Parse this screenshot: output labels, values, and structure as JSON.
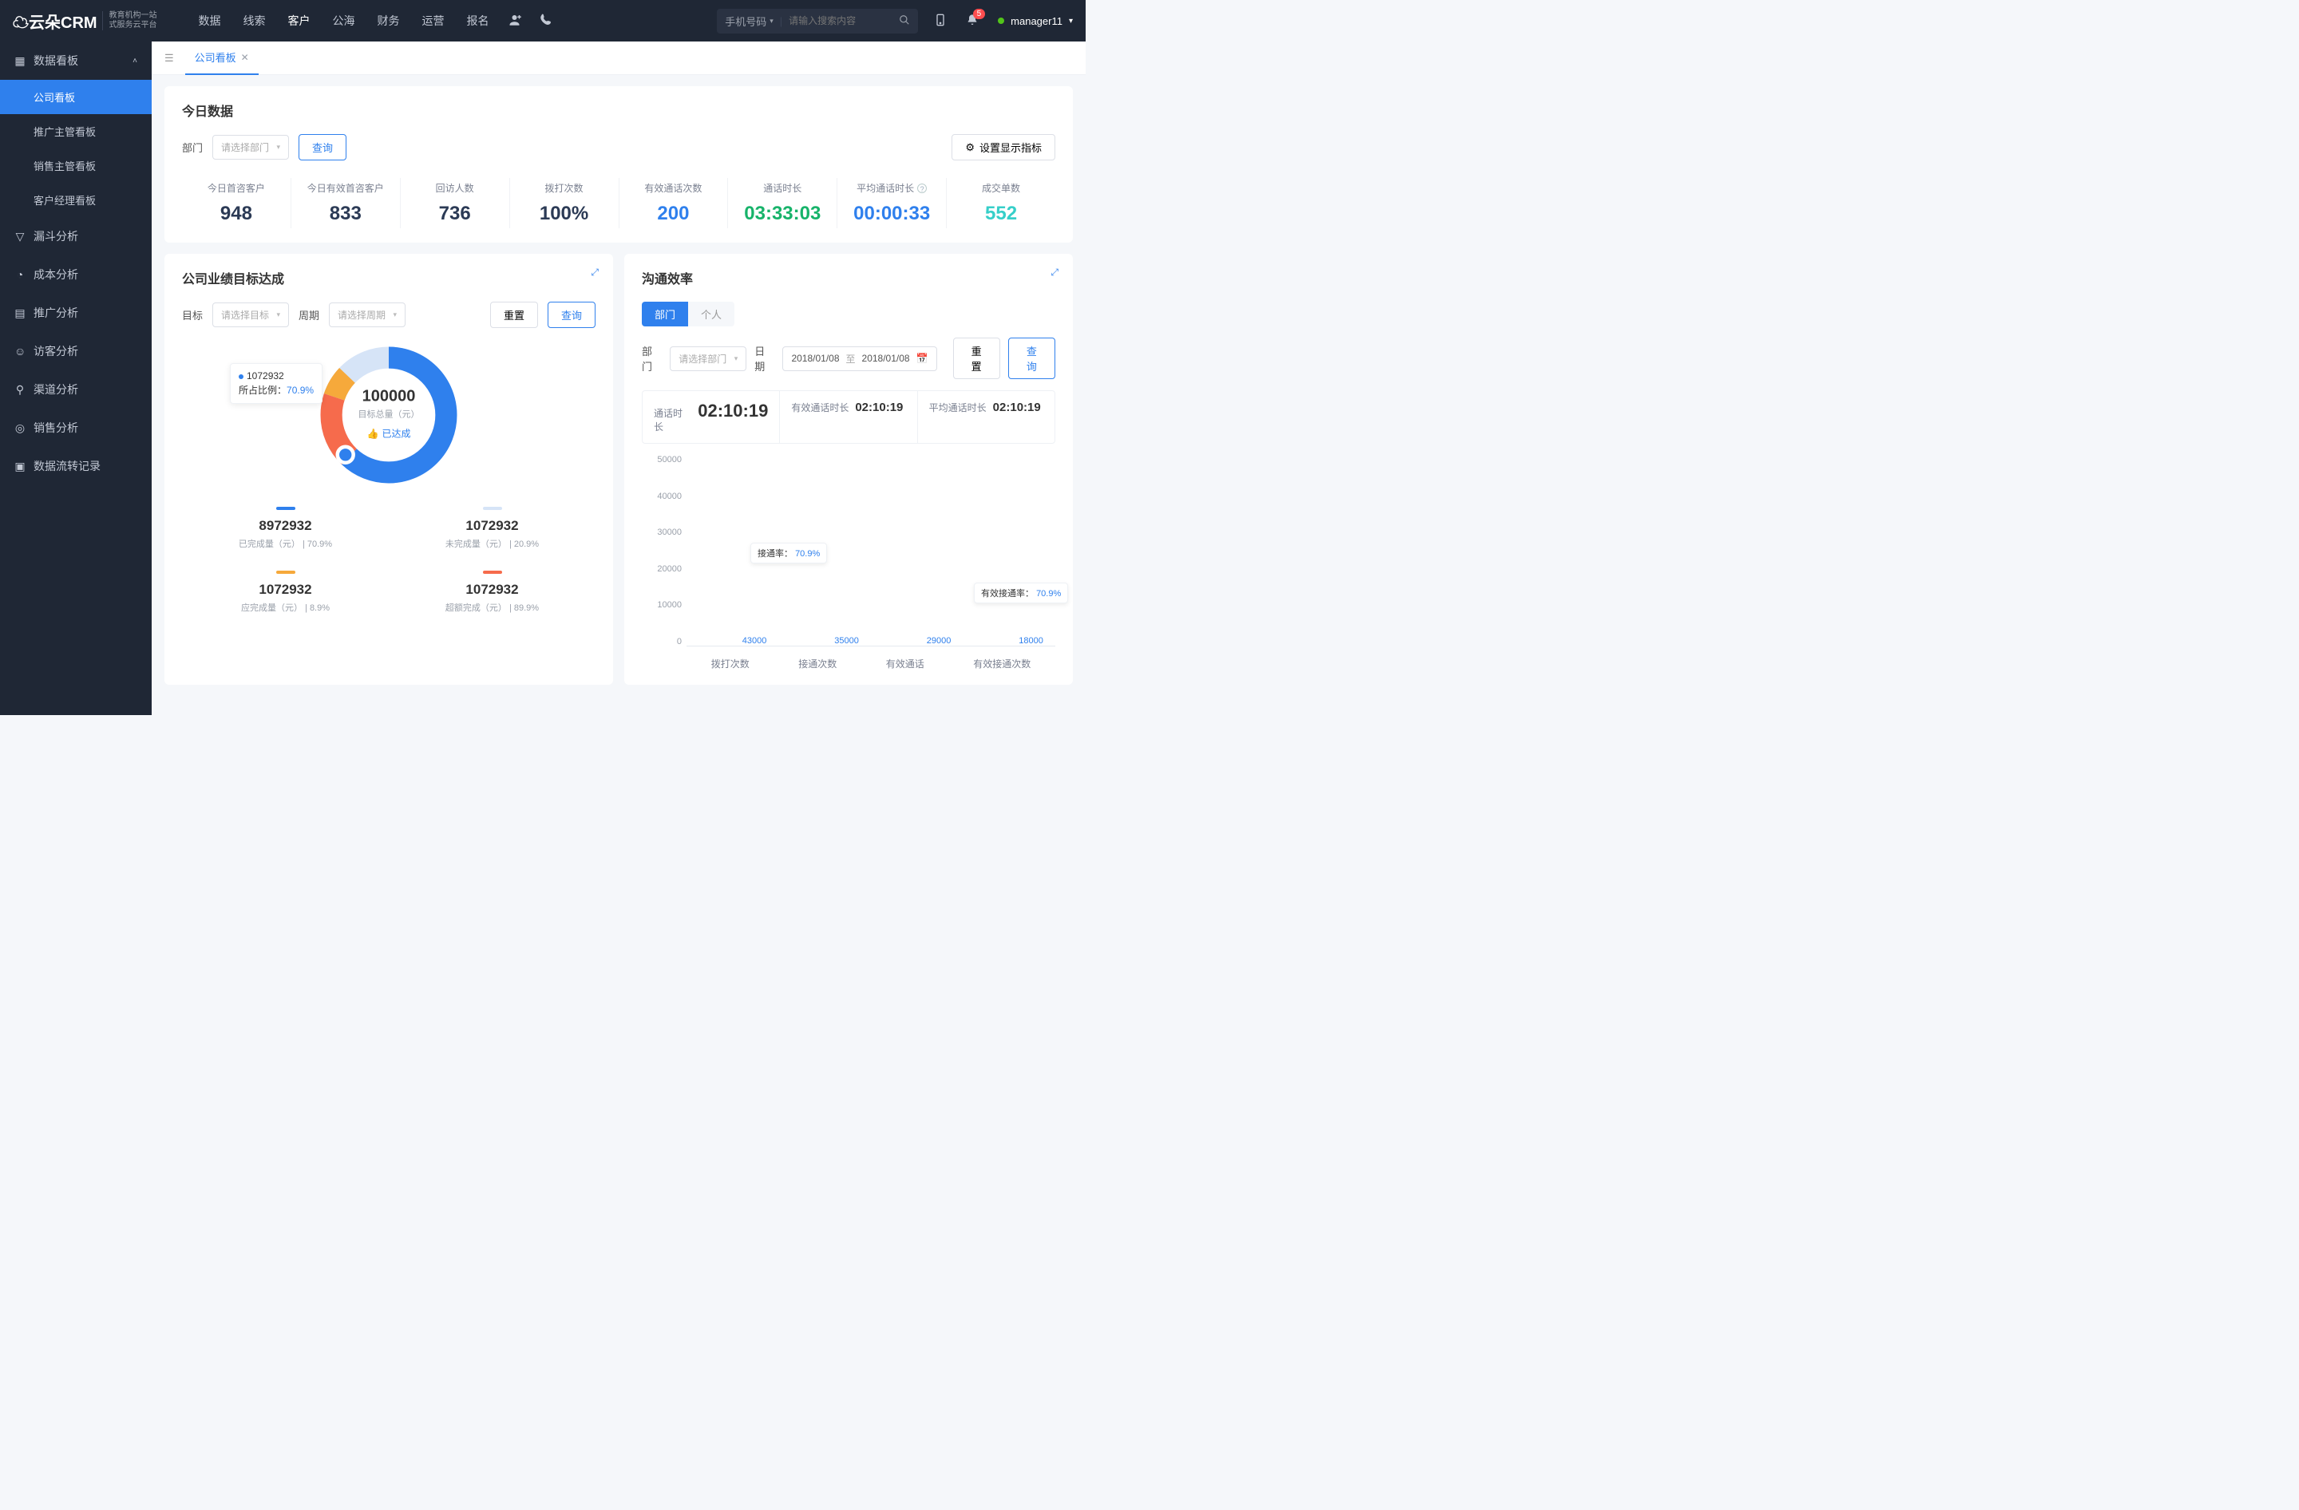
{
  "header": {
    "logo": "云朵CRM",
    "logoUrl": "www.yunduocrm.com",
    "logoSub1": "教育机构一站",
    "logoSub2": "式服务云平台",
    "nav": [
      "数据",
      "线索",
      "客户",
      "公海",
      "财务",
      "运营",
      "报名"
    ],
    "navActive": 2,
    "searchType": "手机号码",
    "searchPlaceholder": "请输入搜索内容",
    "notifCount": "5",
    "user": "manager11"
  },
  "sidebar": {
    "group": "数据看板",
    "subs": [
      "公司看板",
      "推广主管看板",
      "销售主管看板",
      "客户经理看板"
    ],
    "subActive": 0,
    "items": [
      {
        "icon": "▽",
        "label": "漏斗分析"
      },
      {
        "icon": "◔",
        "label": "成本分析"
      },
      {
        "icon": "▤",
        "label": "推广分析"
      },
      {
        "icon": "☺",
        "label": "访客分析"
      },
      {
        "icon": "⚲",
        "label": "渠道分析"
      },
      {
        "icon": "◎",
        "label": "销售分析"
      },
      {
        "icon": "▣",
        "label": "数据流转记录"
      }
    ]
  },
  "tab": {
    "label": "公司看板"
  },
  "today": {
    "title": "今日数据",
    "deptLabel": "部门",
    "deptPlaceholder": "请选择部门",
    "query": "查询",
    "settingsBtn": "设置显示指标",
    "metrics": [
      {
        "label": "今日首咨客户",
        "value": "948",
        "cls": "c-navy"
      },
      {
        "label": "今日有效首咨客户",
        "value": "833",
        "cls": "c-navy"
      },
      {
        "label": "回访人数",
        "value": "736",
        "cls": "c-navy"
      },
      {
        "label": "拨打次数",
        "value": "100%",
        "cls": "c-navy"
      },
      {
        "label": "有效通话次数",
        "value": "200",
        "cls": "c-blue"
      },
      {
        "label": "通话时长",
        "value": "03:33:03",
        "cls": "c-green"
      },
      {
        "label": "平均通话时长",
        "value": "00:00:33",
        "cls": "c-blue",
        "help": true
      },
      {
        "label": "成交单数",
        "value": "552",
        "cls": "c-cyan"
      }
    ]
  },
  "target": {
    "title": "公司业绩目标达成",
    "goalLabel": "目标",
    "goalPlaceholder": "请选择目标",
    "periodLabel": "周期",
    "periodPlaceholder": "请选择周期",
    "reset": "重置",
    "query": "查询",
    "centerValue": "100000",
    "centerSub": "目标总量（元）",
    "centerTag": "已达成",
    "tipValue": "1072932",
    "tipRatioLabel": "所占比例：",
    "tipRatio": "70.9%",
    "stats": [
      {
        "color": "#2f80ed",
        "value": "8972932",
        "sub": "已完成量（元） | 70.9%"
      },
      {
        "color": "#d6e4f7",
        "value": "1072932",
        "sub": "未完成量（元） | 20.9%"
      },
      {
        "color": "#f6a93b",
        "value": "1072932",
        "sub": "应完成量（元） | 8.9%"
      },
      {
        "color": "#f66b4c",
        "value": "1072932",
        "sub": "超额完成（元） | 89.9%"
      }
    ]
  },
  "eff": {
    "title": "沟通效率",
    "tabs": [
      "部门",
      "个人"
    ],
    "tabActive": 0,
    "deptLabel": "部门",
    "deptPlaceholder": "请选择部门",
    "dateLabel": "日期",
    "dateFrom": "2018/01/08",
    "dateTo": "2018/01/08",
    "dateSep": "至",
    "reset": "重置",
    "query": "查询",
    "header": [
      {
        "k": "通话时长",
        "v": "02:10:19",
        "big": true
      },
      {
        "k": "有效通话时长",
        "v": "02:10:19"
      },
      {
        "k": "平均通话时长",
        "v": "02:10:19"
      }
    ],
    "ymax": 50000,
    "yticks": [
      "50000",
      "40000",
      "30000",
      "20000",
      "10000",
      "0"
    ]
  },
  "chart_data": [
    {
      "type": "pie",
      "title": "公司业绩目标达成",
      "values": [
        {
          "name": "已完成量",
          "value": 8972932,
          "pct": 70.9,
          "color": "#2f80ed"
        },
        {
          "name": "未完成量",
          "value": 1072932,
          "pct": 20.9,
          "color": "#d6e4f7"
        },
        {
          "name": "应完成量",
          "value": 1072932,
          "pct": 8.9,
          "color": "#f6a93b"
        },
        {
          "name": "超额完成",
          "value": 1072932,
          "pct": 89.9,
          "color": "#f66b4c"
        }
      ],
      "centerTotal": 100000,
      "centerUnit": "目标总量（元）",
      "annotations": [
        {
          "label": "1072932",
          "ratio": "70.9%"
        }
      ]
    },
    {
      "type": "bar",
      "title": "沟通效率",
      "categories": [
        "拨打次数",
        "接通次数",
        "有效通话",
        "有效接通次数"
      ],
      "values": [
        43000,
        35000,
        29000,
        18000
      ],
      "ylabel": "",
      "ylim": [
        0,
        50000
      ],
      "annotations": [
        {
          "label": "接通率：",
          "value": "70.9%"
        },
        {
          "label": "有效接通率：",
          "value": "70.9%"
        }
      ]
    }
  ]
}
